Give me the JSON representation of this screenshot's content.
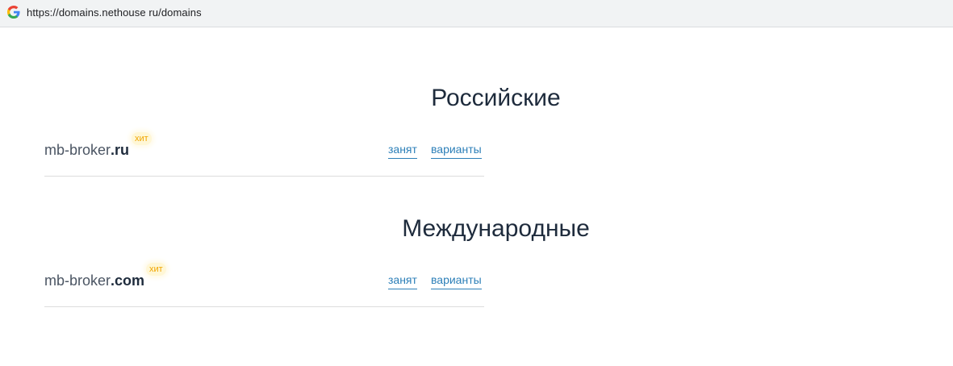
{
  "browser": {
    "url": "https://domains.nethouse ru/domains"
  },
  "sections": [
    {
      "title": "Российские",
      "domain": {
        "base": "mb-broker",
        "tld": ".ru",
        "badge": "хит",
        "status_link": "занят",
        "variants_link": "варианты"
      }
    },
    {
      "title": "Международные",
      "domain": {
        "base": "mb-broker",
        "tld": ".com",
        "badge": "хит",
        "status_link": "занят",
        "variants_link": "варианты"
      }
    }
  ],
  "colors": {
    "title": "#1e2b3c",
    "link": "#2c7fb8",
    "badge_text": "#f0a500",
    "badge_bg": "#fff7d6"
  },
  "icons": {
    "browser_favicon": "google-g-icon"
  }
}
